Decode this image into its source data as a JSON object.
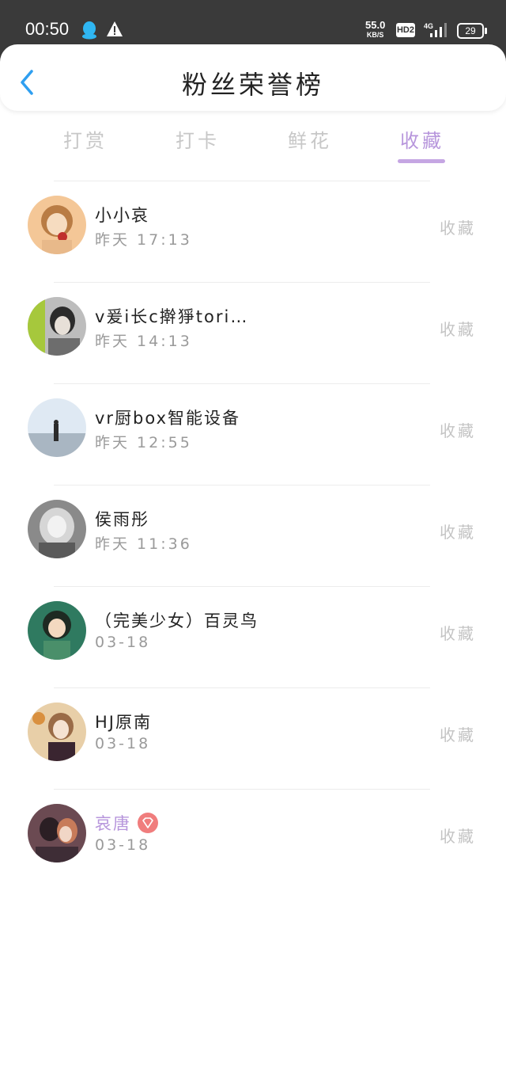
{
  "status_bar": {
    "time": "00:50",
    "net_speed": "55.0",
    "net_unit": "KB/S",
    "hd": "HD2",
    "network": "4G",
    "battery": "29"
  },
  "header": {
    "title": "粉丝荣誉榜",
    "back_icon": "chevron-left-icon"
  },
  "tabs": [
    {
      "label": "打赏",
      "active": false
    },
    {
      "label": "打卡",
      "active": false
    },
    {
      "label": "鲜花",
      "active": false
    },
    {
      "label": "收藏",
      "active": true
    }
  ],
  "accent": "#b796dc",
  "rows": [
    {
      "name": "小小哀",
      "time": "昨天 17:13",
      "action": "收藏",
      "vip": false
    },
    {
      "name": "v爰i长c擀猙tori…",
      "time": "昨天 14:13",
      "action": "收藏",
      "vip": false
    },
    {
      "name": "vr厨box智能设备",
      "time": "昨天 12:55",
      "action": "收藏",
      "vip": false
    },
    {
      "name": "侯雨彤",
      "time": "昨天 11:36",
      "action": "收藏",
      "vip": false
    },
    {
      "name": "（完美少女）百灵鸟",
      "time": "03-18",
      "action": "收藏",
      "vip": false
    },
    {
      "name": "HJ原南",
      "time": "03-18",
      "action": "收藏",
      "vip": false
    },
    {
      "name": "哀唐",
      "time": "03-18",
      "action": "收藏",
      "vip": true
    }
  ]
}
